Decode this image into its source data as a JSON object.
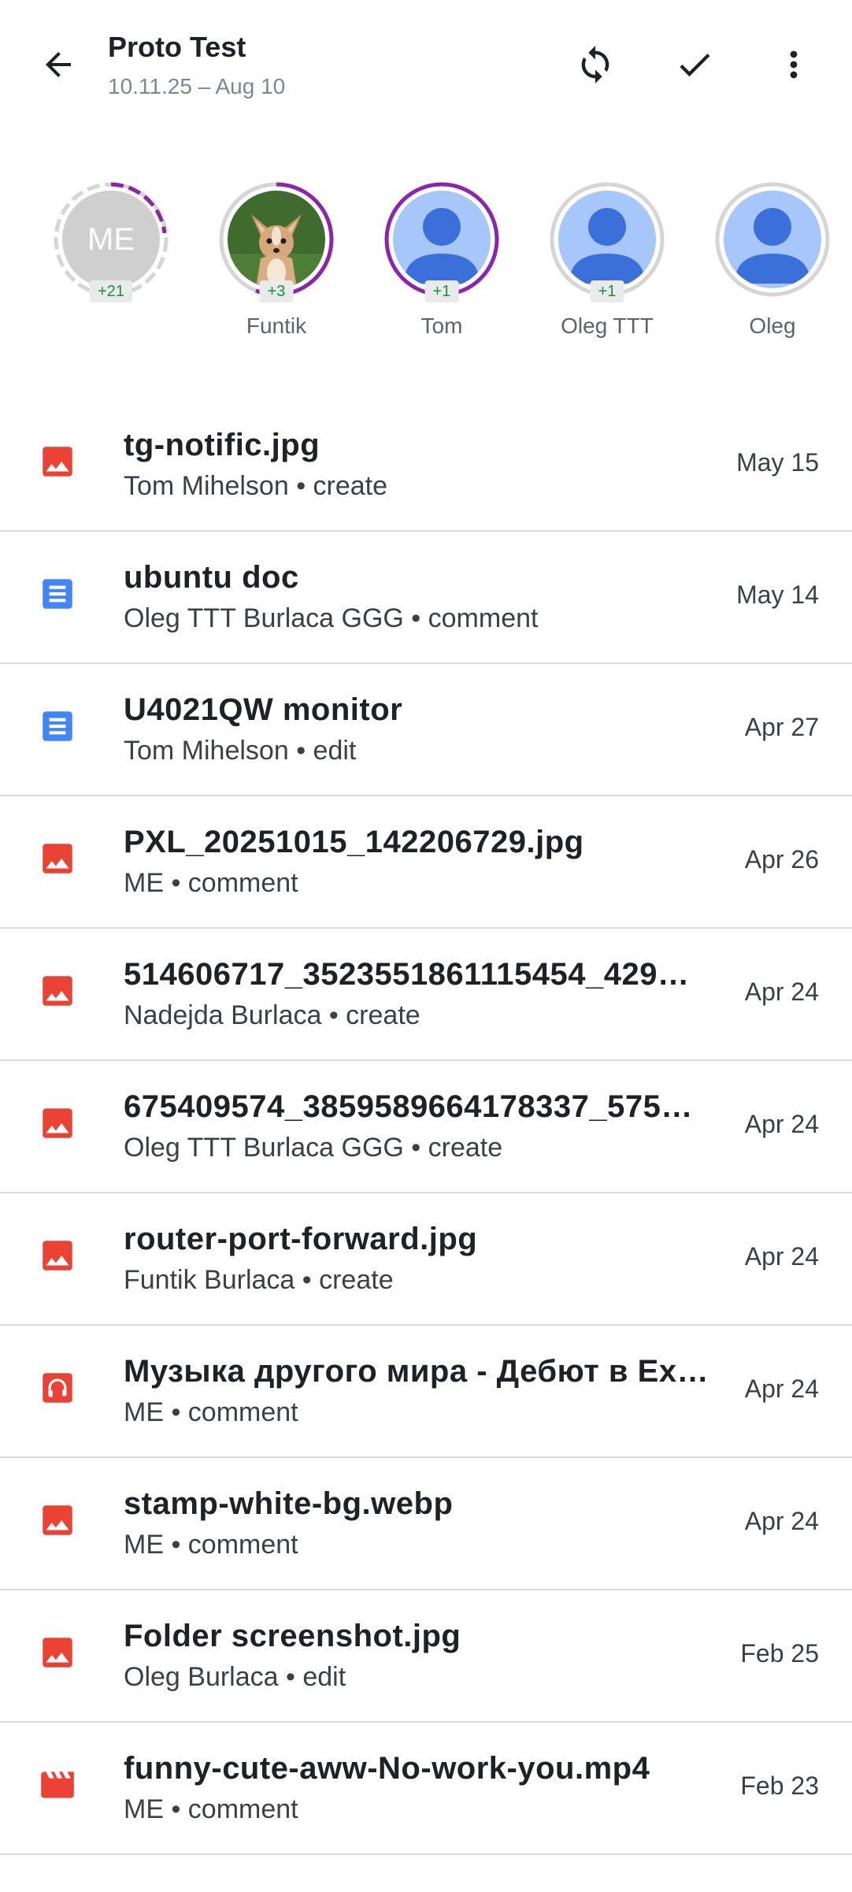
{
  "header": {
    "title": "Proto Test",
    "subtitle": "10.11.25 – Aug 10",
    "icons": {
      "back": "arrow-back-icon",
      "sync": "sync-icon",
      "check": "check-icon",
      "more": "more-vert-icon"
    }
  },
  "participants": [
    {
      "initials": "ME",
      "name": "",
      "badge": "+21",
      "avatar": "initials",
      "ring": "dashed-partial"
    },
    {
      "initials": "",
      "name": "Funtik",
      "badge": "+3",
      "avatar": "dog-photo",
      "ring": "partial"
    },
    {
      "initials": "",
      "name": "Tom",
      "badge": "+1",
      "avatar": "person-icon",
      "ring": "full"
    },
    {
      "initials": "",
      "name": "Oleg TTT",
      "badge": "+1",
      "avatar": "person-icon",
      "ring": "gray"
    },
    {
      "initials": "",
      "name": "Oleg",
      "badge": "",
      "avatar": "person-icon",
      "ring": "gray"
    }
  ],
  "files": [
    {
      "name": "tg-notific.jpg",
      "meta": "Tom Mihelson • create",
      "date": "May 15",
      "icon": "image-icon"
    },
    {
      "name": "ubuntu doc",
      "meta": "Oleg TTT Burlaca GGG • comment",
      "date": "May 14",
      "icon": "doc-icon"
    },
    {
      "name": "U4021QW monitor",
      "meta": "Tom Mihelson • edit",
      "date": "Apr 27",
      "icon": "doc-icon"
    },
    {
      "name": "PXL_20251015_142206729.jpg",
      "meta": "ME • comment",
      "date": "Apr 26",
      "icon": "image-icon"
    },
    {
      "name": "514606717_3523551861115454_429…",
      "meta": "Nadejda Burlaca • create",
      "date": "Apr 24",
      "icon": "image-icon"
    },
    {
      "name": "675409574_3859589664178337_575…",
      "meta": "Oleg TTT Burlaca GGG • create",
      "date": "Apr 24",
      "icon": "image-icon"
    },
    {
      "name": "router-port-forward.jpg",
      "meta": "Funtik Burlaca • create",
      "date": "Apr 24",
      "icon": "image-icon"
    },
    {
      "name": "Музыка другого мира - Дебют в Ex…",
      "meta": "ME • comment",
      "date": "Apr 24",
      "icon": "audio-icon"
    },
    {
      "name": "stamp-white-bg.webp",
      "meta": "ME • comment",
      "date": "Apr 24",
      "icon": "image-icon"
    },
    {
      "name": "Folder screenshot.jpg",
      "meta": "Oleg Burlaca • edit",
      "date": "Feb 25",
      "icon": "image-icon"
    },
    {
      "name": "funny-cute-aww-No-work-you.mp4",
      "meta": "ME • comment",
      "date": "Feb 23",
      "icon": "video-icon"
    }
  ],
  "colors": {
    "accent": "#8e24aa",
    "image_icon": "#ea4335",
    "doc_icon": "#4285f4",
    "badge_text": "#1e8e3e",
    "divider": "#dadce0",
    "avatar_person_bg": "#a7c7fa",
    "avatar_person_fg": "#3b6fd9"
  }
}
